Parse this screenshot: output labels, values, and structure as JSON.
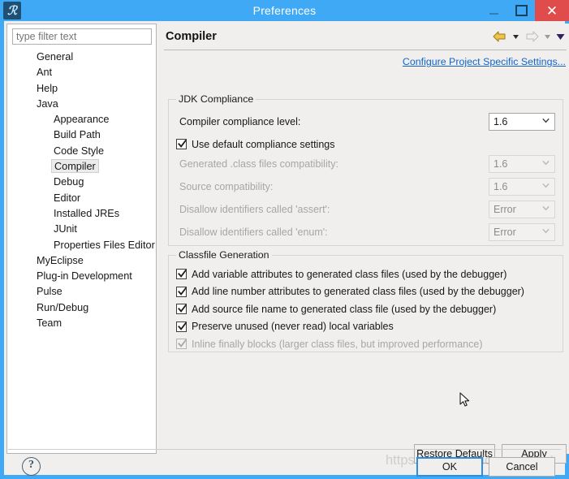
{
  "window": {
    "title": "Preferences",
    "app_icon": "eclipse-icon",
    "controls": {
      "minimize": "minimize-icon",
      "maximize": "maximize-icon",
      "close": "close-icon"
    },
    "titlebar_color": "#3fa9f5",
    "close_color": "#e04c4c"
  },
  "sidebar": {
    "filter_placeholder": "type filter text",
    "filter_value": "",
    "selected": "Compiler",
    "items": [
      {
        "label": "General",
        "level": 0
      },
      {
        "label": "Ant",
        "level": 0
      },
      {
        "label": "Help",
        "level": 0
      },
      {
        "label": "Java",
        "level": 0
      },
      {
        "label": "Appearance",
        "level": 1
      },
      {
        "label": "Build Path",
        "level": 1
      },
      {
        "label": "Code Style",
        "level": 1
      },
      {
        "label": "Compiler",
        "level": 1,
        "selected": true
      },
      {
        "label": "Debug",
        "level": 1
      },
      {
        "label": "Editor",
        "level": 1
      },
      {
        "label": "Installed JREs",
        "level": 1
      },
      {
        "label": "JUnit",
        "level": 1
      },
      {
        "label": "Properties Files Editor",
        "level": 1
      },
      {
        "label": "MyEclipse",
        "level": 0
      },
      {
        "label": "Plug-in Development",
        "level": 0
      },
      {
        "label": "Pulse",
        "level": 0
      },
      {
        "label": "Run/Debug",
        "level": 0
      },
      {
        "label": "Team",
        "level": 0
      }
    ]
  },
  "content": {
    "title": "Compiler",
    "configure_link": "Configure Project Specific Settings...",
    "nav": {
      "back": "back-arrow-icon",
      "back_menu": "back-dropdown-icon",
      "forward": "forward-arrow-icon",
      "forward_menu": "forward-dropdown-icon",
      "menu": "view-menu-icon"
    },
    "jdk_compliance": {
      "title": "JDK Compliance",
      "rows": [
        {
          "label": "Compiler compliance level:",
          "value": "1.6",
          "disabled": false,
          "type": "combo"
        },
        {
          "label": "Use default compliance settings",
          "checked": true,
          "disabled": false,
          "type": "checkbox"
        },
        {
          "label": "Generated .class files compatibility:",
          "value": "1.6",
          "disabled": true,
          "type": "combo"
        },
        {
          "label": "Source compatibility:",
          "value": "1.6",
          "disabled": true,
          "type": "combo"
        },
        {
          "label": "Disallow identifiers called 'assert':",
          "value": "Error",
          "disabled": true,
          "type": "combo"
        },
        {
          "label": "Disallow identifiers called 'enum':",
          "value": "Error",
          "disabled": true,
          "type": "combo"
        }
      ]
    },
    "classfile_generation": {
      "title": "Classfile Generation",
      "checkboxes": [
        {
          "label": "Add variable attributes to generated class files (used by the debugger)",
          "checked": true,
          "disabled": false
        },
        {
          "label": "Add line number attributes to generated class files (used by the debugger)",
          "checked": true,
          "disabled": false
        },
        {
          "label": "Add source file name to generated class file (used by the debugger)",
          "checked": true,
          "disabled": false
        },
        {
          "label": "Preserve unused (never read) local variables",
          "checked": true,
          "disabled": false
        },
        {
          "label": "Inline finally blocks (larger class files, but improved performance)",
          "checked": true,
          "disabled": true
        }
      ]
    }
  },
  "buttons": {
    "restore_defaults": "Restore Defaults",
    "apply": "Apply",
    "ok": "OK",
    "cancel": "Cancel",
    "help": "?"
  },
  "watermark": "https://aqaedu.blog.csdn.net",
  "colors": {
    "accent": "#3fa9f5",
    "link": "#1464c8",
    "dialog_bg": "#f0efed",
    "focus_border": "#2b8ee0"
  }
}
